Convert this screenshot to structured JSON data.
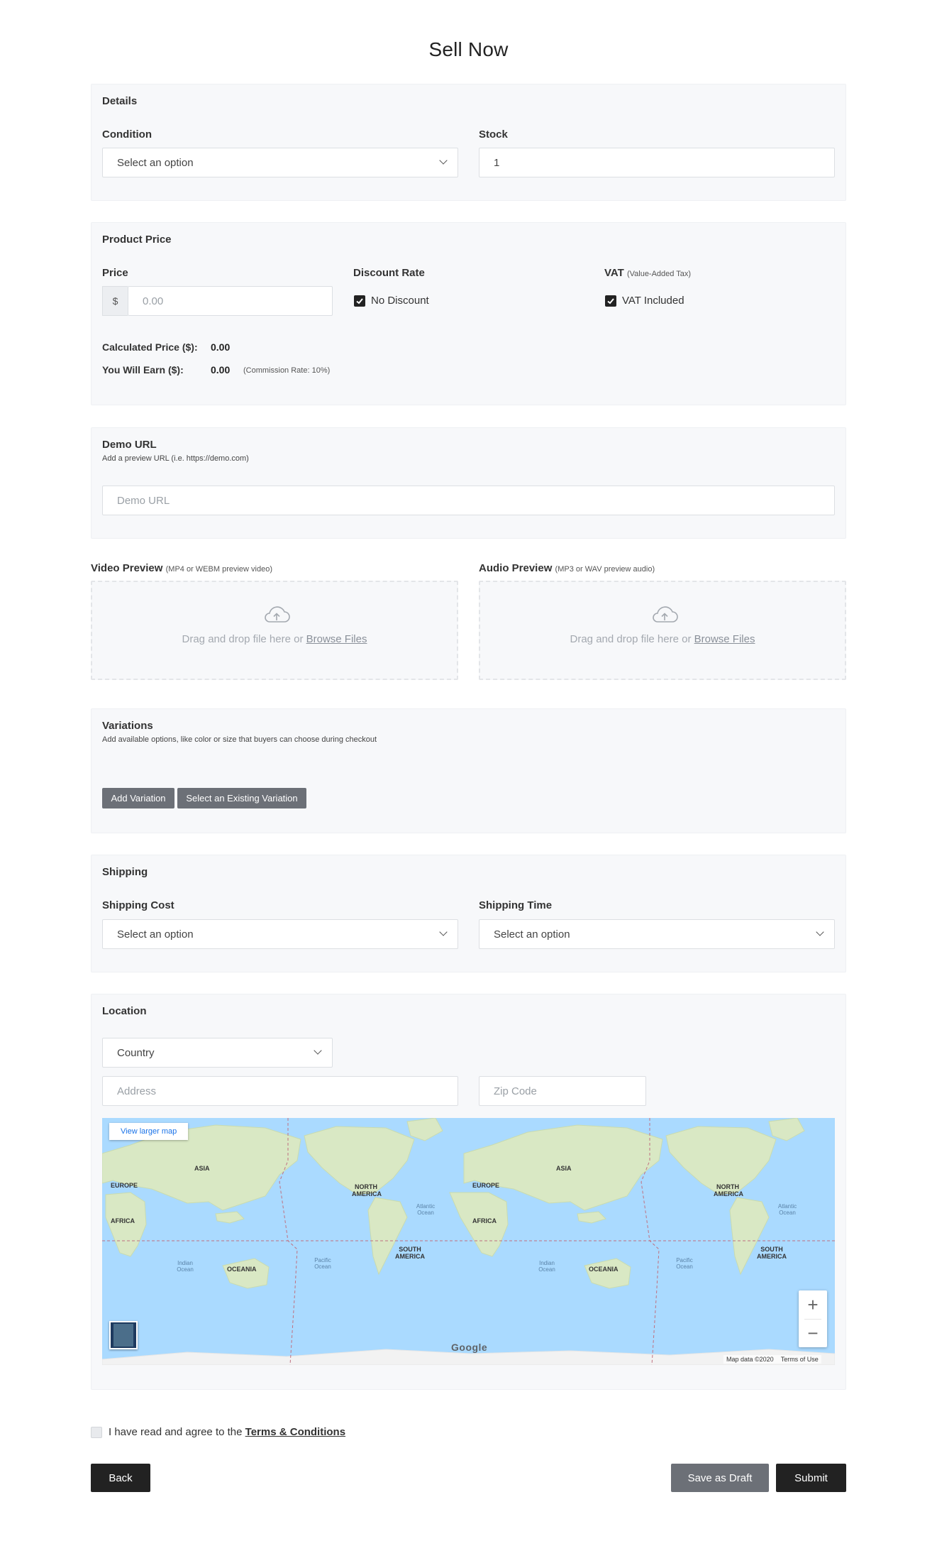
{
  "page_title": "Sell Now",
  "details": {
    "title": "Details",
    "condition_label": "Condition",
    "condition_value": "Select an option",
    "stock_label": "Stock",
    "stock_value": "1"
  },
  "product_price": {
    "title": "Product Price",
    "price_label": "Price",
    "currency_symbol": "$",
    "price_placeholder": "0.00",
    "discount_label": "Discount Rate",
    "discount_checkbox": "No Discount",
    "vat_label": "VAT",
    "vat_note": "(Value-Added Tax)",
    "vat_checkbox": "VAT Included",
    "calculated_label": "Calculated Price ($):",
    "calculated_value": "0.00",
    "earn_label": "You Will Earn ($):",
    "earn_value": "0.00",
    "commission_note": "(Commission Rate:  10%)"
  },
  "demo": {
    "title": "Demo URL",
    "hint": "Add a preview URL (i.e. https://demo.com)",
    "placeholder": "Demo URL"
  },
  "video_preview": {
    "label": "Video Preview",
    "note": "(MP4 or WEBM preview video)",
    "drop_text": "Drag and drop file here or ",
    "browse_link": "Browse Files"
  },
  "audio_preview": {
    "label": "Audio Preview",
    "note": "(MP3 or WAV preview audio)",
    "drop_text": "Drag and drop file here or ",
    "browse_link": "Browse Files"
  },
  "variations": {
    "title": "Variations",
    "hint": "Add available options, like color or size that buyers can choose during checkout",
    "add_button": "Add Variation",
    "existing_button": "Select an Existing Variation"
  },
  "shipping": {
    "title": "Shipping",
    "cost_label": "Shipping Cost",
    "cost_value": "Select an option",
    "time_label": "Shipping Time",
    "time_value": "Select an option"
  },
  "location": {
    "title": "Location",
    "country_value": "Country",
    "address_placeholder": "Address",
    "zip_placeholder": "Zip Code",
    "map": {
      "view_larger": "View larger map",
      "labels": [
        "ASIA",
        "EUROPE",
        "AFRICA",
        "OCEANIA",
        "NORTH AMERICA",
        "SOUTH AMERICA"
      ],
      "ocean_labels": [
        "Indian Ocean",
        "Pacific Ocean",
        "Atlantic Ocean"
      ],
      "google": "Google",
      "map_data": "Map data ©2020",
      "terms_of_use": "Terms of Use",
      "zoom_in": "+",
      "zoom_out": "−"
    }
  },
  "terms": {
    "text": "I have read and agree to the ",
    "link": "Terms & Conditions"
  },
  "buttons": {
    "back": "Back",
    "save_draft": "Save as Draft",
    "submit": "Submit"
  },
  "colors": {
    "card_bg": "#f7f8fa",
    "primary_dark": "#222222",
    "secondary_grey": "#6c7077",
    "map_water": "#aadaff",
    "map_land": "#d9e8c4"
  }
}
